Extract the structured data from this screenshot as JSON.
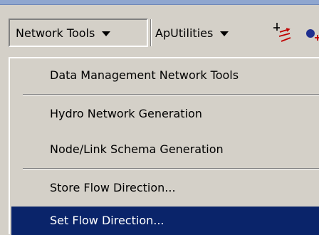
{
  "toolbar": {
    "network_tools_label": "Network Tools",
    "aputilities_label": "ApUtilities",
    "icons": [
      "flow-arrows-icon",
      "add-node-icon"
    ]
  },
  "menu": {
    "items": [
      {
        "label": "Data Management Network Tools",
        "highlighted": false
      },
      {
        "label": "Hydro Network Generation",
        "highlighted": false
      },
      {
        "label": "Node/Link Schema Generation",
        "highlighted": false
      },
      {
        "label": "Store Flow Direction...",
        "highlighted": false
      },
      {
        "label": "Set Flow Direction...",
        "highlighted": true
      }
    ]
  },
  "colors": {
    "highlight_bg": "#0a246a",
    "highlight_text": "#ffffff",
    "face": "#d4d0c8"
  }
}
